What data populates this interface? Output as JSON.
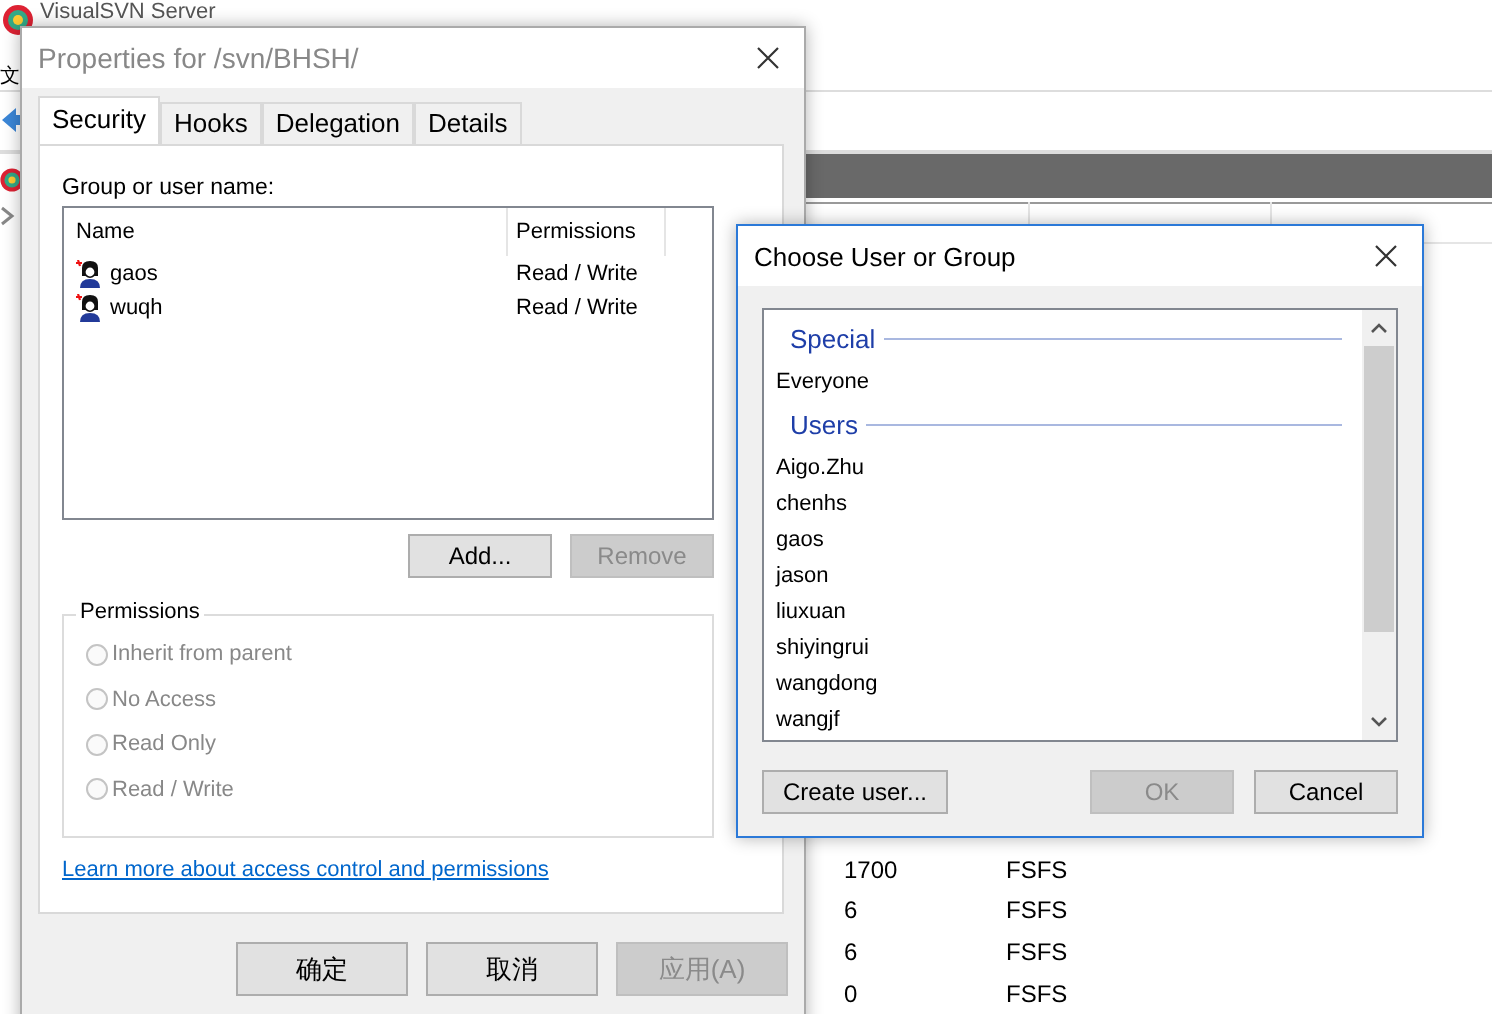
{
  "app": {
    "title": "VisualSVN Server",
    "menu": [
      "文"
    ],
    "table": {
      "rows": [
        {
          "revisions": "1700",
          "type": "FSFS"
        },
        {
          "revisions": "6",
          "type": "FSFS"
        },
        {
          "revisions": "6",
          "type": "FSFS"
        },
        {
          "revisions": "0",
          "type": "FSFS"
        }
      ]
    }
  },
  "properties_dialog": {
    "title": "Properties for /svn/BHSH/",
    "tabs": [
      {
        "label": "Security",
        "selected": true
      },
      {
        "label": "Hooks",
        "selected": false
      },
      {
        "label": "Delegation",
        "selected": false
      },
      {
        "label": "Details",
        "selected": false
      }
    ],
    "list_label": "Group or user name:",
    "columns": [
      "Name",
      "Permissions"
    ],
    "entries": [
      {
        "name": "gaos",
        "permissions": "Read / Write",
        "selected": false
      },
      {
        "name": "wuqh",
        "permissions": "Read / Write",
        "selected": false
      }
    ],
    "list_buttons": [
      {
        "label": "Add...",
        "disabled": false
      },
      {
        "label": "Remove",
        "disabled": true
      }
    ],
    "permissions": {
      "title": "Permissions",
      "options": [
        {
          "label": "Inherit from parent",
          "selected": false,
          "disabled": true
        },
        {
          "label": "No Access",
          "selected": false,
          "disabled": true
        },
        {
          "label": "Read Only",
          "selected": false,
          "disabled": true
        },
        {
          "label": "Read / Write",
          "selected": false,
          "disabled": true
        }
      ]
    },
    "link": "Learn more about access control and permissions",
    "buttons": [
      {
        "label": "确定",
        "disabled": false
      },
      {
        "label": "取消",
        "disabled": false
      },
      {
        "label": "应用(A)",
        "disabled": true
      }
    ]
  },
  "choose_dialog": {
    "title": "Choose User or Group",
    "items": [
      {
        "kind": "group",
        "label": "Special"
      },
      {
        "kind": "item",
        "label": "Everyone",
        "selected": false
      },
      {
        "kind": "group",
        "label": "Users"
      },
      {
        "kind": "item",
        "label": "Aigo.Zhu",
        "selected": false
      },
      {
        "kind": "item",
        "label": "chenhs",
        "selected": false
      },
      {
        "kind": "item",
        "label": "gaos",
        "selected": false
      },
      {
        "kind": "item",
        "label": "jason",
        "selected": false
      },
      {
        "kind": "item",
        "label": "liuxuan",
        "selected": false
      },
      {
        "kind": "item",
        "label": "shiyingrui",
        "selected": false
      },
      {
        "kind": "item",
        "label": "wangdong",
        "selected": false
      },
      {
        "kind": "item",
        "label": "wangjf",
        "selected": false
      }
    ],
    "buttons": [
      {
        "label": "Create user...",
        "disabled": false
      },
      {
        "label": "OK",
        "disabled": true
      },
      {
        "label": "Cancel",
        "disabled": false
      }
    ]
  }
}
